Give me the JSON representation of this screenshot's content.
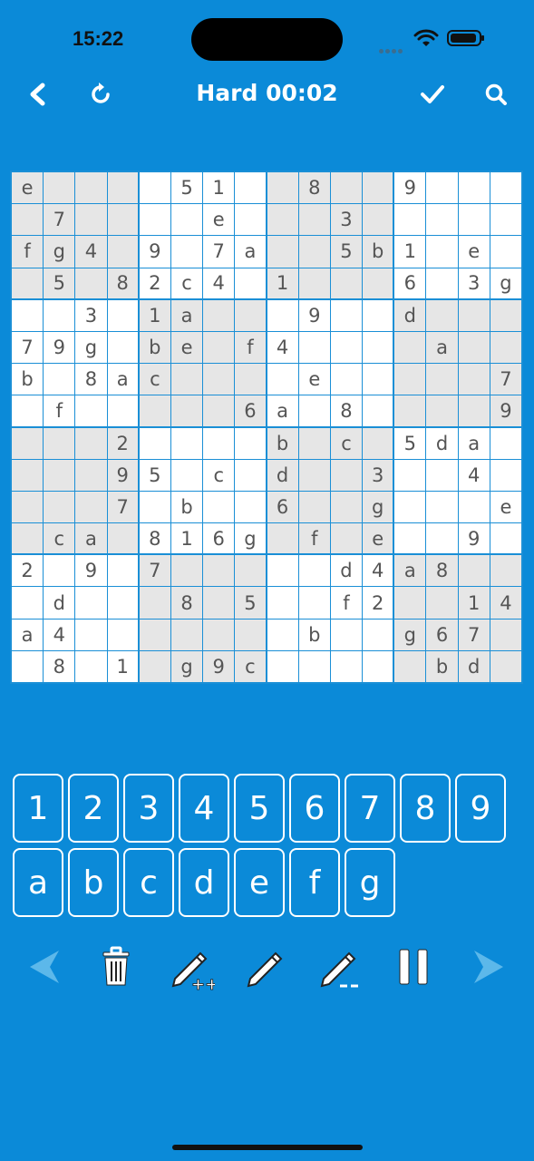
{
  "status_bar": {
    "time": "15:22"
  },
  "header": {
    "title": "Hard 00:02"
  },
  "icons": {
    "back": "back-chevron-icon",
    "restart": "restart-icon",
    "check": "checkmark-icon",
    "search": "search-icon",
    "prev": "previous-arrow-icon",
    "trash": "trash-icon",
    "notes_auto": "pencil-plus-icon",
    "pencil": "pencil-icon",
    "pencil_minus": "pencil-minus-icon",
    "pause": "pause-icon",
    "next": "next-arrow-icon"
  },
  "colors": {
    "background": "#0b8ad8",
    "cell_shaded": "#e6e6e6",
    "cell_text": "#555555"
  },
  "grid": {
    "size": 16,
    "rows": [
      [
        "e",
        "",
        "",
        "",
        "",
        "5",
        "1",
        "",
        "",
        "8",
        "",
        "",
        "9",
        "",
        "",
        ""
      ],
      [
        "",
        "7",
        "",
        "",
        "",
        "",
        "e",
        "",
        "",
        "",
        "3",
        "",
        "",
        "",
        "",
        ""
      ],
      [
        "f",
        "g",
        "4",
        "",
        "9",
        "",
        "7",
        "a",
        "",
        "",
        "5",
        "b",
        "1",
        "",
        "e",
        ""
      ],
      [
        "",
        "5",
        "",
        "8",
        "2",
        "c",
        "4",
        "",
        "1",
        "",
        "",
        "",
        "6",
        "",
        "3",
        "g"
      ],
      [
        "",
        "",
        "3",
        "",
        "1",
        "a",
        "",
        "",
        "",
        "9",
        "",
        "",
        "d",
        "",
        "",
        ""
      ],
      [
        "7",
        "9",
        "g",
        "",
        "b",
        "e",
        "",
        "f",
        "4",
        "",
        "",
        "",
        "",
        "a",
        "",
        ""
      ],
      [
        "b",
        "",
        "8",
        "a",
        "c",
        "",
        "",
        "",
        "",
        "e",
        "",
        "",
        "",
        "",
        "",
        "7"
      ],
      [
        "",
        "f",
        "",
        "",
        "",
        "",
        "",
        "6",
        "a",
        "",
        "8",
        "",
        "",
        "",
        "",
        "9"
      ],
      [
        "",
        "",
        "",
        "2",
        "",
        "",
        "",
        "",
        "b",
        "",
        "c",
        "",
        "5",
        "d",
        "a",
        ""
      ],
      [
        "",
        "",
        "",
        "9",
        "5",
        "",
        "c",
        "",
        "d",
        "",
        "",
        "3",
        "",
        "",
        "4",
        ""
      ],
      [
        "",
        "",
        "",
        "7",
        "",
        "b",
        "",
        "",
        "6",
        "",
        "",
        "g",
        "",
        "",
        "",
        "e"
      ],
      [
        "",
        "c",
        "a",
        "",
        "8",
        "1",
        "6",
        "g",
        "",
        "f",
        "",
        "e",
        "",
        "",
        "9",
        ""
      ],
      [
        "2",
        "",
        "9",
        "",
        "7",
        "",
        "",
        "",
        "",
        "",
        "d",
        "4",
        "a",
        "8",
        "",
        ""
      ],
      [
        "",
        "d",
        "",
        "",
        "",
        "8",
        "",
        "5",
        "",
        "",
        "f",
        "2",
        "",
        "",
        "1",
        "4"
      ],
      [
        "a",
        "4",
        "",
        "",
        "",
        "",
        "",
        "",
        "",
        "b",
        "",
        "",
        "g",
        "6",
        "7",
        ""
      ],
      [
        "",
        "8",
        "",
        "1",
        "",
        "g",
        "9",
        "c",
        "",
        "",
        "",
        "",
        "",
        "b",
        "d",
        ""
      ]
    ]
  },
  "keypad": {
    "row1": [
      "1",
      "2",
      "3",
      "4",
      "5",
      "6",
      "7",
      "8",
      "9"
    ],
    "row2": [
      "a",
      "b",
      "c",
      "d",
      "e",
      "f",
      "g"
    ]
  }
}
